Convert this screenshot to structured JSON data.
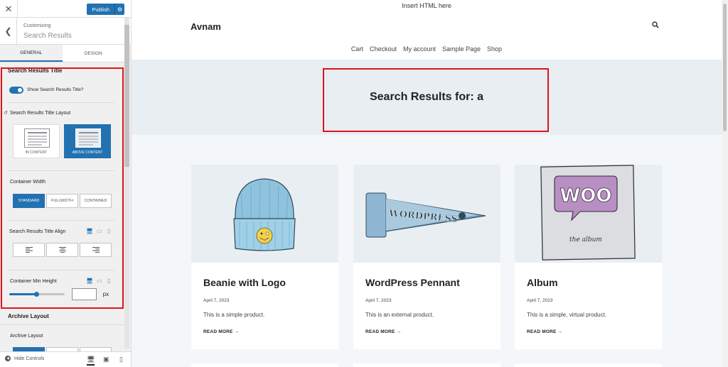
{
  "customizer": {
    "close_glyph": "✕",
    "publish_label": "Publish",
    "customizing_label": "Customizing",
    "section_title": "Search Results",
    "tabs": [
      {
        "label": "General",
        "active": true
      },
      {
        "label": "Design",
        "active": false
      }
    ],
    "title_group": {
      "heading": "Search Results Title",
      "toggle_label": "Show Search Results Title?",
      "toggle_on": true,
      "layout_label": "Search Results Title Layout",
      "layout_options": [
        {
          "label": "In Content",
          "active": false
        },
        {
          "label": "Above Content",
          "active": true
        }
      ],
      "width_label": "Container Width",
      "width_options": [
        {
          "label": "Standard",
          "active": true
        },
        {
          "label": "Fullwidth",
          "active": false
        },
        {
          "label": "Contained",
          "active": false
        }
      ],
      "align_label": "Search Results Title Align",
      "align_options": [
        "left-align-icon",
        "center-align-icon",
        "right-align-icon"
      ],
      "min_height_label": "Container Min Height",
      "min_height_slider_fraction": 0.49,
      "min_height_value": "",
      "min_height_unit": "px"
    },
    "archive_group": {
      "heading": "Archive Layout",
      "layout_label": "Archive Layout"
    },
    "footer": {
      "hide_controls": "Hide Controls"
    },
    "colors": {
      "accent": "#2271b1",
      "highlight": "#e0131b"
    }
  },
  "site": {
    "header_html": "Insert HTML here",
    "title": "Avnam",
    "nav": [
      "Cart",
      "Checkout",
      "My account",
      "Sample Page",
      "Shop"
    ],
    "results_title": "Search Results for: a"
  },
  "products": [
    {
      "title": "Beanie with Logo",
      "date": "April 7, 2023",
      "excerpt": "This is a simple product.",
      "more": "READ MORE →",
      "image": "beanie-image"
    },
    {
      "title": "WordPress Pennant",
      "date": "April 7, 2023",
      "excerpt": "This is an external product.",
      "more": "READ MORE →",
      "image": "pennant-image",
      "pennant_text": "WORDPRESS"
    },
    {
      "title": "Album",
      "date": "April 7, 2023",
      "excerpt": "This is a simple, virtual product.",
      "more": "READ MORE →",
      "image": "album-image",
      "album_logo": "WOO",
      "album_caption": "the album"
    }
  ]
}
